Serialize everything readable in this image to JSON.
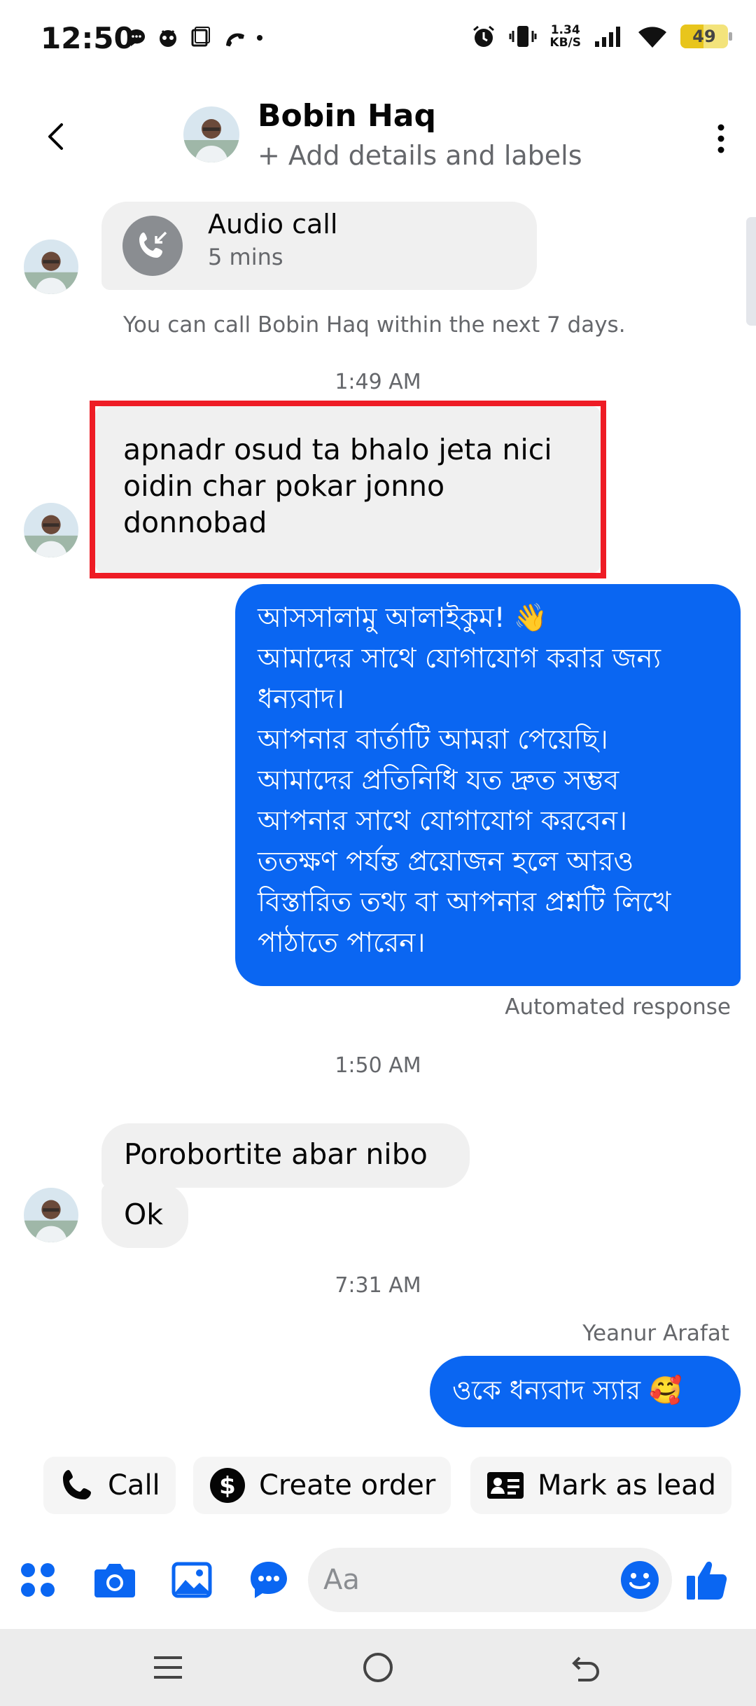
{
  "status_bar": {
    "time": "12:50",
    "net_speed_value": "1.34",
    "net_speed_unit": "KB/S",
    "battery_percent": 49
  },
  "header": {
    "contact_name": "Bobin Haq",
    "subtitle": "+ Add details and labels"
  },
  "conversation": {
    "call_card": {
      "title": "Audio call",
      "duration": "5 mins"
    },
    "call_note": "You can call Bobin Haq within the next 7 days.",
    "timestamp_1": "1:49 AM",
    "incoming_1": {
      "line1": "apnadr osud ta bhalo jeta nici",
      "line2": "oidin char pokar jonno",
      "line3": "donnobad"
    },
    "outgoing_1": {
      "lines": [
        "আসসালামু আলাইকুম! 👋",
        "আমাদের সাথে যোগাযোগ করার জন্য",
        "ধন্যবাদ।",
        "আপনার বার্তাটি আমরা পেয়েছি।",
        "আমাদের প্রতিনিধি যত দ্রুত সম্ভব",
        "আপনার সাথে যোগাযোগ করবেন।",
        "ততক্ষণ পর্যন্ত প্রয়োজন হলে আরও",
        "বিস্তারিত তথ্য বা আপনার প্রশ্নটি লিখে",
        "পাঠাতে পারেন।"
      ]
    },
    "automated_label": "Automated response",
    "timestamp_2": "1:50 AM",
    "incoming_2": {
      "line1": "Porobortite abar nibo",
      "line2": "Ok"
    },
    "timestamp_3": "7:31 AM",
    "sender_name": "Yeanur Arafat",
    "outgoing_2": "ওকে ধন্যবাদ স্যার 🥰"
  },
  "quick_actions": {
    "call": "Call",
    "create_order": "Create order",
    "mark_as_lead": "Mark as lead"
  },
  "composer": {
    "placeholder": "Aa"
  },
  "colors": {
    "accent": "#0a66f2",
    "highlight": "#ee1c25",
    "bubble_incoming": "#f0f0f0"
  }
}
